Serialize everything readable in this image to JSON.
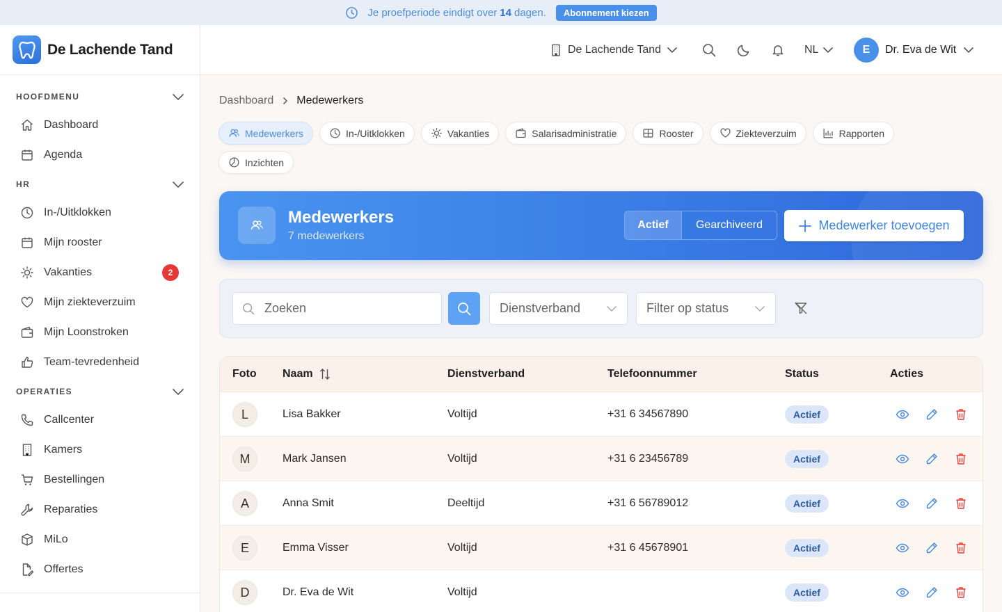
{
  "banner": {
    "text_before": "Je proefperiode eindigt over",
    "days": "14",
    "text_after": "dagen.",
    "button": "Abonnement kiezen"
  },
  "brand": {
    "name": "De Lachende Tand"
  },
  "topbar": {
    "org": "De Lachende Tand",
    "lang": "NL",
    "user_initial": "E",
    "user_name": "Dr. Eva de Wit"
  },
  "sidebar": {
    "sections": [
      {
        "title": "HOOFDMENU",
        "items": [
          {
            "label": "Dashboard",
            "icon": "home-icon"
          },
          {
            "label": "Agenda",
            "icon": "calendar-icon"
          }
        ]
      },
      {
        "title": "HR",
        "items": [
          {
            "label": "In-/Uitklokken",
            "icon": "clock-icon"
          },
          {
            "label": "Mijn rooster",
            "icon": "calendar-icon"
          },
          {
            "label": "Vakanties",
            "icon": "sun-icon",
            "badge": "2"
          },
          {
            "label": "Mijn ziekteverzuim",
            "icon": "heart-icon"
          },
          {
            "label": "Mijn Loonstroken",
            "icon": "wallet-icon"
          },
          {
            "label": "Team-tevredenheid",
            "icon": "thumbs-up-icon"
          }
        ]
      },
      {
        "title": "OPERATIES",
        "items": [
          {
            "label": "Callcenter",
            "icon": "phone-icon"
          },
          {
            "label": "Kamers",
            "icon": "building-icon"
          },
          {
            "label": "Bestellingen",
            "icon": "cart-icon"
          },
          {
            "label": "Reparaties",
            "icon": "wrench-icon"
          },
          {
            "label": "MiLo",
            "icon": "box-icon"
          },
          {
            "label": "Offertes",
            "icon": "file-sign-icon"
          }
        ]
      }
    ]
  },
  "breadcrumb": {
    "parent": "Dashboard",
    "current": "Medewerkers"
  },
  "tabs": [
    {
      "label": "Medewerkers",
      "icon": "users-icon",
      "active": true
    },
    {
      "label": "In-/Uitklokken",
      "icon": "clock-icon"
    },
    {
      "label": "Vakanties",
      "icon": "sun-icon"
    },
    {
      "label": "Salarisadministratie",
      "icon": "wallet-icon"
    },
    {
      "label": "Rooster",
      "icon": "grid-icon"
    },
    {
      "label": "Ziekteverzuim",
      "icon": "heart-icon"
    },
    {
      "label": "Rapporten",
      "icon": "bar-chart-icon"
    },
    {
      "label": "Inzichten",
      "icon": "pie-chart-icon"
    }
  ],
  "hero": {
    "title": "Medewerkers",
    "subtitle": "7 medewerkers",
    "seg_active": "Actief",
    "seg_archived": "Gearchiveerd",
    "add_button": "Medewerker toevoegen"
  },
  "filters": {
    "search_placeholder": "Zoeken",
    "employment_placeholder": "Dienstverband",
    "status_placeholder": "Filter op status"
  },
  "table": {
    "headers": {
      "photo": "Foto",
      "name": "Naam",
      "employment": "Dienstverband",
      "phone": "Telefoonnummer",
      "status": "Status",
      "actions": "Acties"
    },
    "rows": [
      {
        "initial": "L",
        "name": "Lisa Bakker",
        "employment": "Voltijd",
        "phone": "+31 6 34567890",
        "status": "Actief"
      },
      {
        "initial": "M",
        "name": "Mark Jansen",
        "employment": "Voltijd",
        "phone": "+31 6 23456789",
        "status": "Actief"
      },
      {
        "initial": "A",
        "name": "Anna Smit",
        "employment": "Deeltijd",
        "phone": "+31 6 56789012",
        "status": "Actief"
      },
      {
        "initial": "E",
        "name": "Emma Visser",
        "employment": "Voltijd",
        "phone": "+31 6 45678901",
        "status": "Actief"
      },
      {
        "initial": "D",
        "name": "Dr. Eva de Wit",
        "employment": "Voltijd",
        "phone": "",
        "status": "Actief"
      }
    ]
  },
  "colors": {
    "accent": "#3f86e3",
    "danger": "#e53935",
    "status_bg": "#dbe7f8"
  }
}
